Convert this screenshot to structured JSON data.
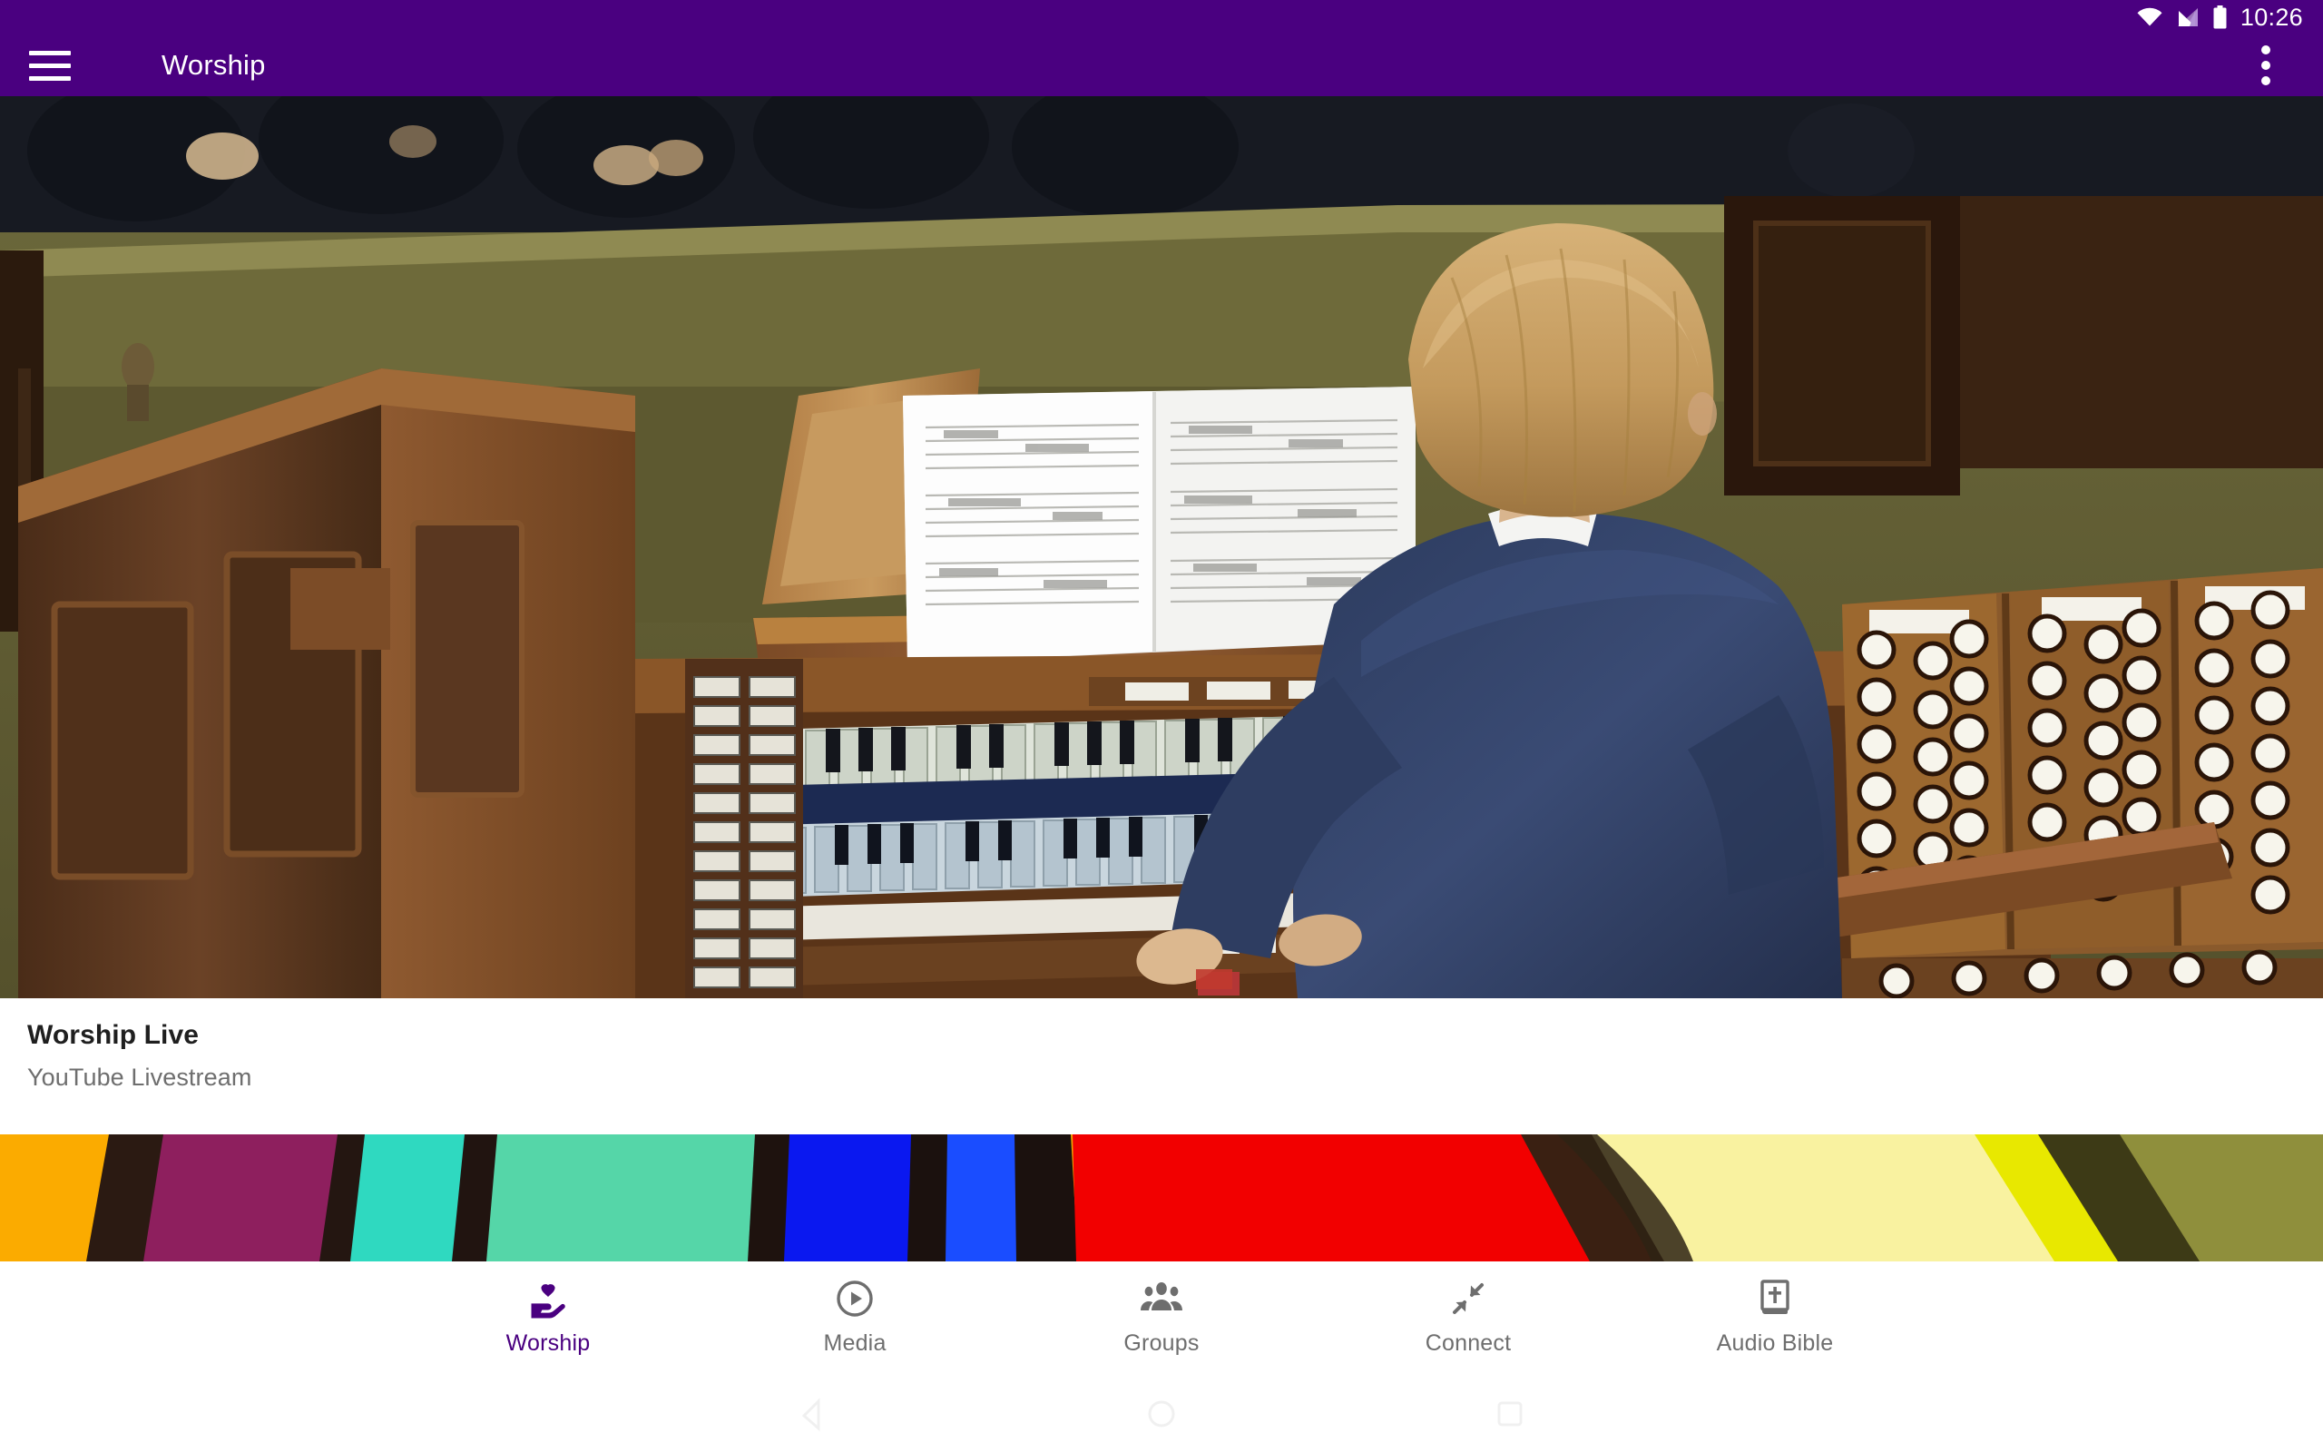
{
  "theme": {
    "primary": "#4A0080",
    "inactive": "#6e6e6e",
    "card_bg": "#ffffff"
  },
  "status_bar": {
    "time": "10:26",
    "icons": [
      "wifi-icon",
      "cellular-signal-icon",
      "battery-icon"
    ]
  },
  "app_bar": {
    "menu_icon": "hamburger-menu-icon",
    "title": "Worship",
    "overflow_icon": "overflow-menu-icon"
  },
  "hero": {
    "alt": "Organist playing a pipe organ in a church sanctuary with choir seated behind"
  },
  "card": {
    "title": "Worship Live",
    "subtitle": "YouTube Livestream"
  },
  "stained_glass": {
    "alt": "Close-up of colorful stained glass window panes"
  },
  "bottom_nav": {
    "items": [
      {
        "label": "Worship",
        "icon": "hand-holding-heart-icon",
        "active": true
      },
      {
        "label": "Media",
        "icon": "play-circle-icon",
        "active": false
      },
      {
        "label": "Groups",
        "icon": "people-group-icon",
        "active": false
      },
      {
        "label": "Connect",
        "icon": "compress-arrows-icon",
        "active": false
      },
      {
        "label": "Audio Bible",
        "icon": "bible-book-icon",
        "active": false
      }
    ]
  },
  "system_nav": {
    "back": "back-triangle-icon",
    "home": "home-circle-icon",
    "recents": "recents-square-icon"
  }
}
